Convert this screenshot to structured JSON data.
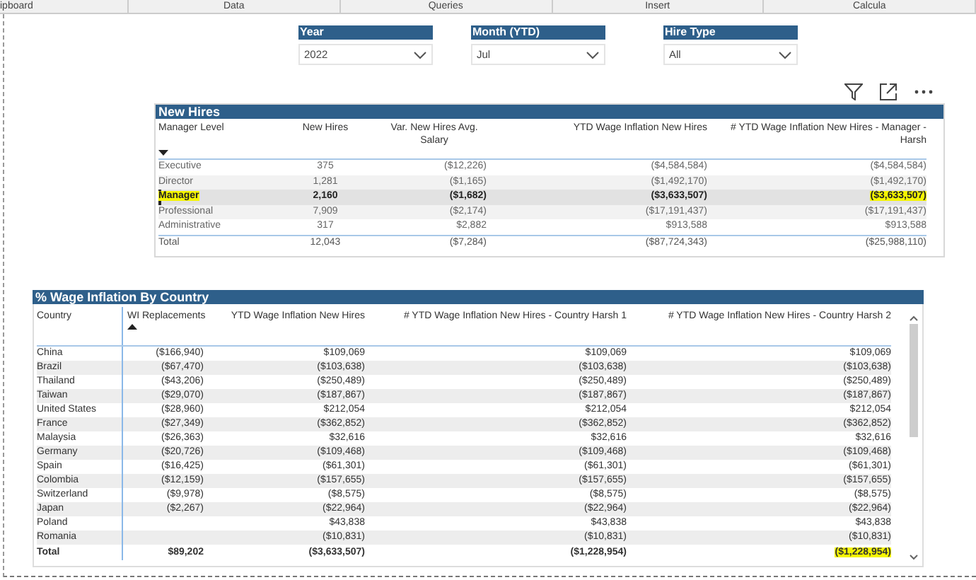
{
  "ribbon": {
    "groups": [
      "ipboard",
      "Data",
      "Queries",
      "Insert",
      "Calcula"
    ]
  },
  "slicers": [
    {
      "title": "Year",
      "value": "2022"
    },
    {
      "title": "Month (YTD)",
      "value": "Jul"
    },
    {
      "title": "Hire Type",
      "value": "All"
    }
  ],
  "new_hires": {
    "title": "New Hires",
    "columns": [
      "Manager Level",
      "New Hires",
      "Var. New Hires Avg. Salary",
      "YTD Wage Inflation New Hires",
      "# YTD Wage Inflation New Hires - Manager - Harsh"
    ],
    "rows": [
      {
        "selected": false,
        "highlighted": false,
        "cells": [
          "Executive",
          "375",
          "($12,226)",
          "($4,584,584)",
          "($4,584,584)"
        ]
      },
      {
        "selected": false,
        "highlighted": false,
        "cells": [
          "Director",
          "1,281",
          "($1,165)",
          "($1,492,170)",
          "($1,492,170)"
        ]
      },
      {
        "selected": true,
        "highlighted": true,
        "cells": [
          "Manager",
          "2,160",
          "($1,682)",
          "($3,633,507)",
          "($3,633,507)"
        ]
      },
      {
        "selected": false,
        "highlighted": false,
        "cells": [
          "Professional",
          "7,909",
          "($2,174)",
          "($17,191,437)",
          "($17,191,437)"
        ]
      },
      {
        "selected": false,
        "highlighted": false,
        "cells": [
          "Administrative",
          "317",
          "$2,882",
          "$913,588",
          "$913,588"
        ]
      }
    ],
    "total": {
      "highlighted": false,
      "cells": [
        "Total",
        "12,043",
        "($7,284)",
        "($87,724,343)",
        "($25,988,110)"
      ]
    }
  },
  "by_country": {
    "title": "% Wage Inflation By Country",
    "columns": [
      "Country",
      "WI Replacements",
      "YTD Wage Inflation New Hires",
      "# YTD Wage Inflation New Hires - Country Harsh 1",
      "# YTD Wage Inflation New Hires - Country Harsh 2"
    ],
    "rows": [
      [
        "China",
        "($166,940)",
        "$109,069",
        "$109,069",
        "$109,069"
      ],
      [
        "Brazil",
        "($67,470)",
        "($103,638)",
        "($103,638)",
        "($103,638)"
      ],
      [
        "Thailand",
        "($43,206)",
        "($250,489)",
        "($250,489)",
        "($250,489)"
      ],
      [
        "Taiwan",
        "($29,070)",
        "($187,867)",
        "($187,867)",
        "($187,867)"
      ],
      [
        "United States",
        "($28,960)",
        "$212,054",
        "$212,054",
        "$212,054"
      ],
      [
        "France",
        "($27,349)",
        "($362,852)",
        "($362,852)",
        "($362,852)"
      ],
      [
        "Malaysia",
        "($26,363)",
        "$32,616",
        "$32,616",
        "$32,616"
      ],
      [
        "Germany",
        "($20,726)",
        "($109,468)",
        "($109,468)",
        "($109,468)"
      ],
      [
        "Spain",
        "($16,425)",
        "($61,301)",
        "($61,301)",
        "($61,301)"
      ],
      [
        "Colombia",
        "($12,159)",
        "($157,655)",
        "($157,655)",
        "($157,655)"
      ],
      [
        "Switzerland",
        "($9,978)",
        "($8,575)",
        "($8,575)",
        "($8,575)"
      ],
      [
        "Japan",
        "($2,267)",
        "($22,964)",
        "($22,964)",
        "($22,964)"
      ],
      [
        "Poland",
        "",
        "$43,838",
        "$43,838",
        "$43,838"
      ],
      [
        "Romania",
        "",
        "($10,831)",
        "($10,831)",
        "($10,831)"
      ]
    ],
    "total": {
      "highlighted": true,
      "cells": [
        "Total",
        "$89,202",
        "($3,633,507)",
        "($1,228,954)",
        "($1,228,954)"
      ]
    }
  }
}
